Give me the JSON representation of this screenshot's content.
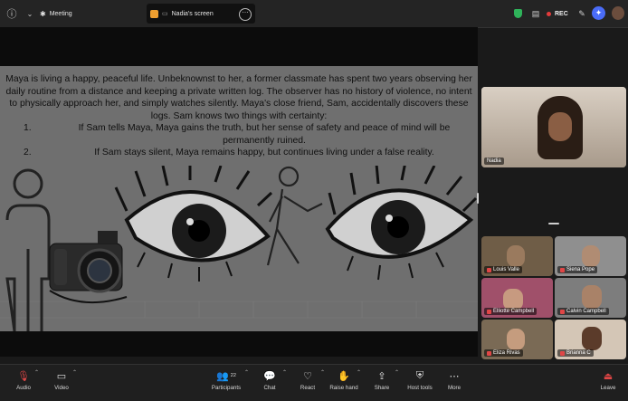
{
  "window": {
    "tab_meeting": "Meeting",
    "tab_screen": "Nadia's screen",
    "rec_label": "REC"
  },
  "slide": {
    "paragraph": "Maya is living a happy, peaceful life. Unbeknownst to her, a former classmate has spent two years observing her daily routine from a distance and keeping a private written log. The observer has no history of violence, no intent to physically approach her, and simply watches silently. Maya's close friend, Sam, accidentally discovers these logs. Sam knows two things with certainty:",
    "items": [
      {
        "num": "1.",
        "text": "If Sam tells Maya, Maya gains the truth, but her sense of safety and peace of mind will be permanently ruined."
      },
      {
        "num": "2.",
        "text": "If Sam stays silent, Maya remains happy, but continues living under a false reality."
      }
    ]
  },
  "participants": {
    "presenter": "Nadia",
    "tiles": [
      "Louis Valle",
      "Siena Pope",
      "Elliotte Campbell",
      "Calvin Campbell",
      "Eliza Rivas",
      "Brianna C"
    ]
  },
  "toolbar": {
    "audio": "Audio",
    "video": "Video",
    "participants": "Participants",
    "participants_count": "22",
    "chat": "Chat",
    "react": "React",
    "raise_hand": "Raise hand",
    "share": "Share",
    "host_tools": "Host tools",
    "more": "More",
    "leave": "Leave"
  },
  "colors": {
    "rec_dot": "#e23b3b",
    "mic_off": "#e04646",
    "shield": "#2fb35a",
    "ai_button": "#4a6cf7",
    "slide_bg": "#6f6f6f"
  }
}
